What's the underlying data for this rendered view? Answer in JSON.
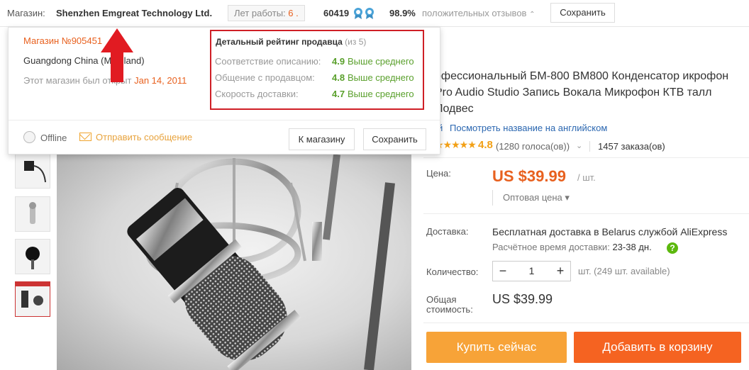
{
  "topbar": {
    "store_label": "Магазин:",
    "store_name": "Shenzhen Emgreat Technology Ltd.",
    "years_label": "Лет работы:",
    "years_value": "6 .",
    "score": "60419",
    "positive_percent": "98.9%",
    "positive_label": "положительных отзывов",
    "save_button": "Сохранить"
  },
  "popup": {
    "store_number": "Магазин №905451",
    "location": "Guangdong China (Mainland)",
    "opened_label": "Этот магазин был открыт",
    "opened_date": "Jan 14, 2011",
    "rating_title": "Детальный рейтинг продавца",
    "rating_scale": "(из 5)",
    "ratings": [
      {
        "label": "Соответствие описанию:",
        "value": "4.9",
        "comparison": "Выше среднего"
      },
      {
        "label": "Общение с продавцом:",
        "value": "4.8",
        "comparison": "Выше среднего"
      },
      {
        "label": "Скорость доставки:",
        "value": "4.7",
        "comparison": "Выше среднего"
      }
    ],
    "status": "Offline",
    "send_message": "Отправить сообщение",
    "to_store_button": "К магазину",
    "save_button": "Сохранить"
  },
  "product": {
    "title": "офессиональный БМ-800 BM800 Конденсатор икрофон Pro Audio Studio Запись Вокала Микрофон КТВ талл Подвес",
    "title_link_prefix": "й",
    "english_link": "Посмотреть название на английском",
    "stars": "★★★★★",
    "rating": "4.8",
    "votes": "(1280 голоса(ов))",
    "orders": "1457 заказа(ов)"
  },
  "price": {
    "label": "Цена:",
    "value": "US $39.99",
    "unit": "/ шт.",
    "wholesale": "Оптовая цена ▾"
  },
  "shipping": {
    "label": "Доставка:",
    "text": "Бесплатная доставка в Belarus службой AliExpress",
    "time_label": "Расчётное время доставки:",
    "time_value": "23-38 дн."
  },
  "quantity": {
    "label": "Количество:",
    "value": "1",
    "minus": "−",
    "plus": "+",
    "unit_info": "шт. (249 шт. available)"
  },
  "total": {
    "label_line1": "Общая",
    "label_line2": "стоимость:",
    "value": "US $39.99"
  },
  "actions": {
    "buy_now": "Купить сейчас",
    "add_to_cart": "Добавить в корзину"
  },
  "colors": {
    "accent_orange": "#e8611f",
    "buy_button": "#f7a338",
    "cart_button": "#f56321",
    "highlight_box": "#cf1f26",
    "positive_green": "#5aa02c",
    "link_blue": "#2a66b0"
  }
}
